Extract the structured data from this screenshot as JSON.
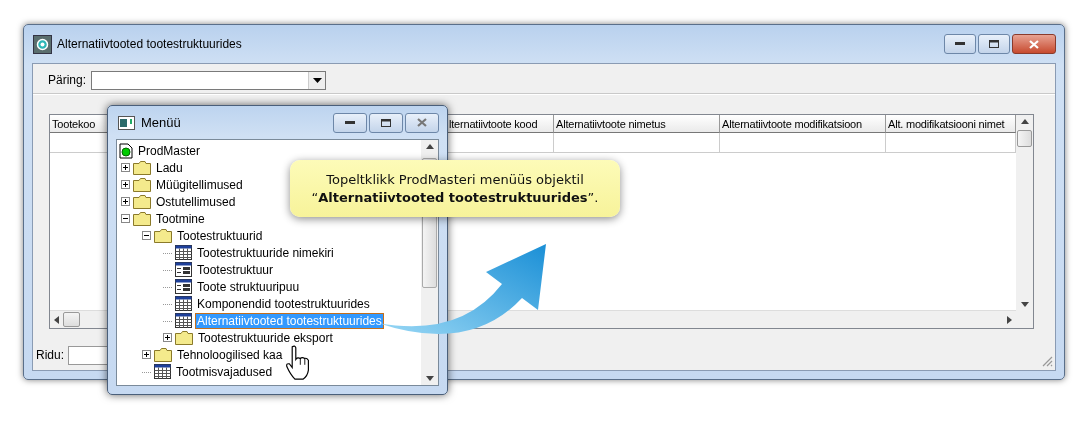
{
  "window": {
    "title": "Alternatiivtooted tootestruktuurides"
  },
  "query": {
    "label": "Päring:"
  },
  "table": {
    "columns": [
      "Tootekoo",
      "lternatiivtoote kood",
      "Alternatiivtoote nimetus",
      "Alternatiivtoote modifikatsioon",
      "Alt. modifikatsiooni nimet"
    ]
  },
  "status_bar": {
    "label": "Ridu:"
  },
  "menu_window": {
    "title": "Menüü",
    "tree": [
      {
        "label": "ProdMaster",
        "kind": "root",
        "selected": false,
        "children": [
          {
            "label": "Ladu",
            "kind": "folder",
            "expanded": false,
            "selected": false
          },
          {
            "label": "Müügitellimused",
            "kind": "folder",
            "expanded": false,
            "selected": false
          },
          {
            "label": "Ostutellimused",
            "kind": "folder",
            "expanded": false,
            "selected": false
          },
          {
            "label": "Tootmine",
            "kind": "folder",
            "expanded": true,
            "selected": false,
            "children": [
              {
                "label": "Tootestruktuurid",
                "kind": "folder",
                "expanded": true,
                "selected": false,
                "children": [
                  {
                    "label": "Tootestruktuuride nimekiri",
                    "kind": "table",
                    "selected": false
                  },
                  {
                    "label": "Tootestruktuur",
                    "kind": "form",
                    "selected": false
                  },
                  {
                    "label": "Toote struktuuripuu",
                    "kind": "form",
                    "selected": false
                  },
                  {
                    "label": "Komponendid tootestruktuurides",
                    "kind": "table",
                    "selected": false
                  },
                  {
                    "label": "Alternatiivtooted tootestruktuurides",
                    "kind": "table",
                    "selected": true
                  },
                  {
                    "label": "Tootestruktuuride eksport",
                    "kind": "folder",
                    "expanded": false,
                    "selected": false
                  }
                ]
              },
              {
                "label": "Tehnoloogilised kaa",
                "kind": "folder",
                "expanded": false,
                "selected": false
              },
              {
                "label": "Tootmisvajadused",
                "kind": "table",
                "selected": false
              }
            ]
          }
        ]
      }
    ]
  },
  "callout": {
    "lines": [
      "Topeltklikk ProdMasteri menüüs objektil",
      "“**Alternatiivtooted tootestruktuurides**”."
    ]
  }
}
